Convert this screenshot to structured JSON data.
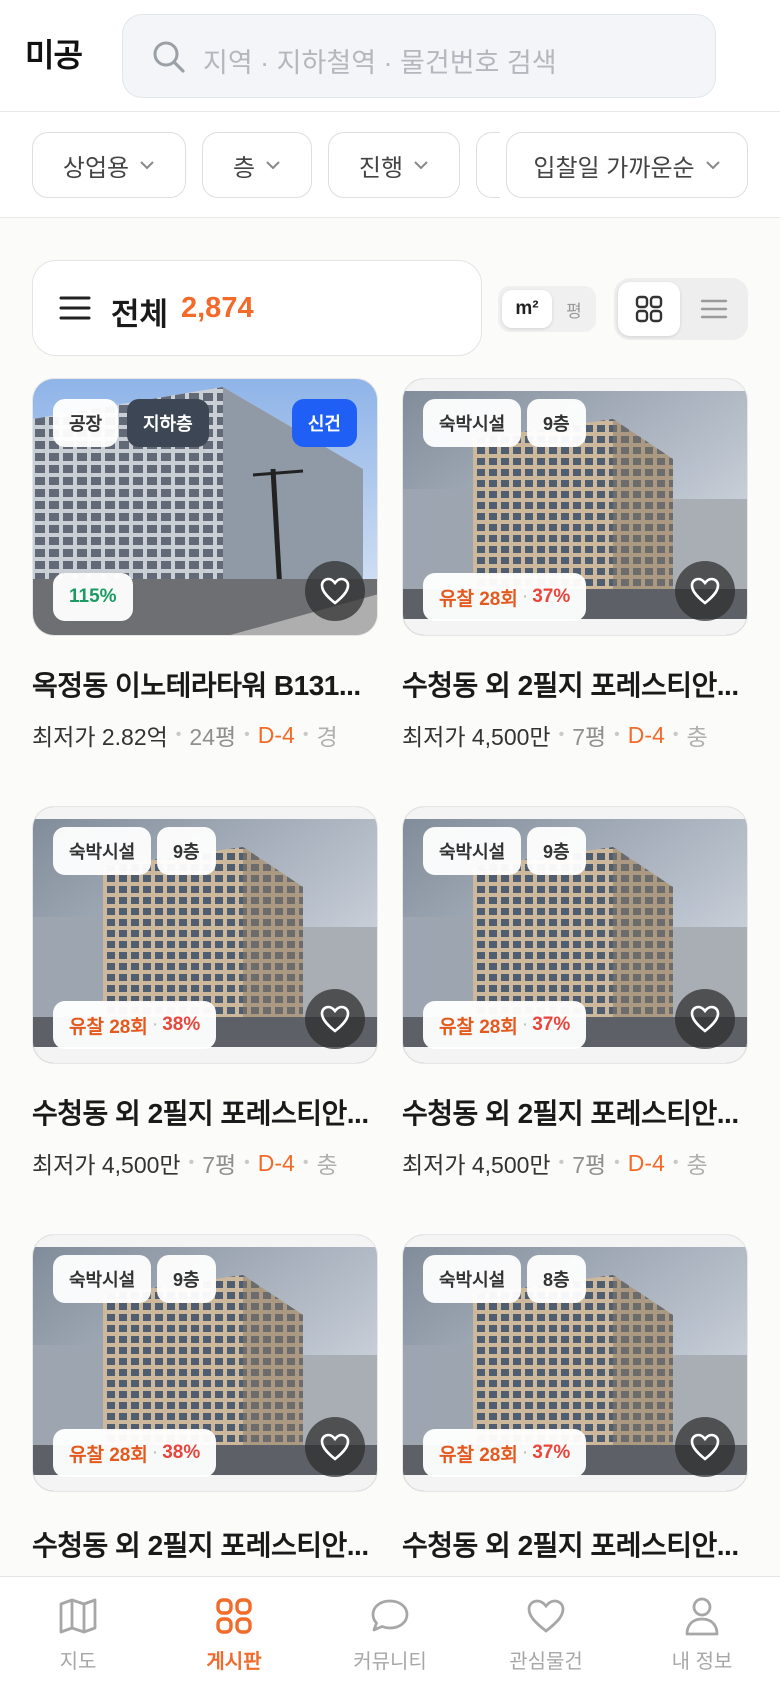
{
  "app": {
    "logo": "미공"
  },
  "search": {
    "placeholder": "지역 · 지하철역 · 물건번호 검색"
  },
  "filters": [
    {
      "label": "상업용"
    },
    {
      "label": "층"
    },
    {
      "label": "진행"
    },
    {
      "label": "입찰일 가까운순"
    }
  ],
  "summary": {
    "label": "전체",
    "count": "2,874"
  },
  "unit_toggle": {
    "active": "m²",
    "inactive": "평"
  },
  "listings": [
    {
      "tag1": "공장",
      "tag2": "지하층",
      "new_badge": "신건",
      "fail": "",
      "pct": "115%",
      "title": "옥정동 이노테라타워 B131...",
      "price": "최저가 2.82억",
      "area": "24평",
      "dday": "D-4",
      "more": "경"
    },
    {
      "tag1": "숙박시설",
      "tag2": "9층",
      "new_badge": "",
      "fail": "유찰 28회",
      "pct": "37%",
      "title": "수청동 외 2필지 포레스티안...",
      "price": "최저가 4,500만",
      "area": "7평",
      "dday": "D-4",
      "more": "충"
    },
    {
      "tag1": "숙박시설",
      "tag2": "9층",
      "new_badge": "",
      "fail": "유찰 28회",
      "pct": "38%",
      "title": "수청동 외 2필지 포레스티안...",
      "price": "최저가 4,500만",
      "area": "7평",
      "dday": "D-4",
      "more": "충"
    },
    {
      "tag1": "숙박시설",
      "tag2": "9층",
      "new_badge": "",
      "fail": "유찰 28회",
      "pct": "37%",
      "title": "수청동 외 2필지 포레스티안...",
      "price": "최저가 4,500만",
      "area": "7평",
      "dday": "D-4",
      "more": "충"
    },
    {
      "tag1": "숙박시설",
      "tag2": "9층",
      "new_badge": "",
      "fail": "유찰 28회",
      "pct": "38%",
      "title": "수청동 외 2필지 포레스티안...",
      "price": "",
      "area": "",
      "dday": "",
      "more": ""
    },
    {
      "tag1": "숙박시설",
      "tag2": "8층",
      "new_badge": "",
      "fail": "유찰 28회",
      "pct": "37%",
      "title": "수청동 외 2필지 포레스티안...",
      "price": "",
      "area": "",
      "dday": "",
      "more": ""
    }
  ],
  "bottom_nav": [
    {
      "label": "지도",
      "icon": "map-icon"
    },
    {
      "label": "게시판",
      "icon": "grid-icon",
      "active": true
    },
    {
      "label": "커뮤니티",
      "icon": "chat-bubble-icon"
    },
    {
      "label": "관심물건",
      "icon": "heart-icon"
    },
    {
      "label": "내 정보",
      "icon": "person-icon"
    }
  ],
  "colors": {
    "accent": "#f26b2a",
    "new_badge": "#1f5ff5",
    "fail": "#e45a1e",
    "pct": "#e8463d",
    "pct_positive": "#1a9b63"
  }
}
